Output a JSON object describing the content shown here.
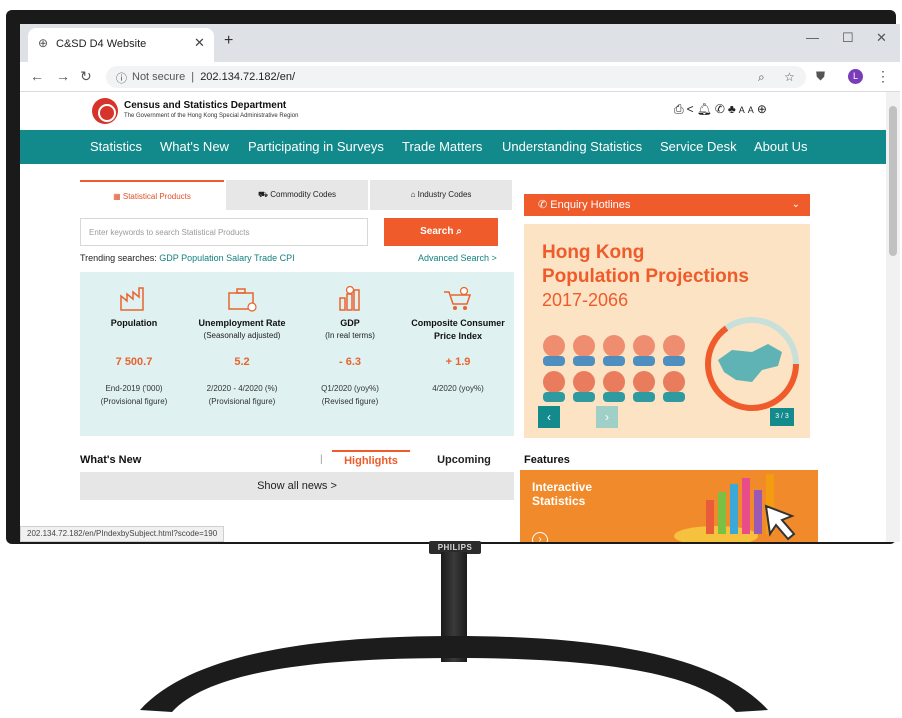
{
  "browser": {
    "tab_title": "C&SD D4 Website",
    "tab_close": "✕",
    "new_tab": "+",
    "address_security": "Not secure",
    "address_separator": "|",
    "address_url": "202.134.72.182/en/",
    "profile_initial": "L",
    "status_url": "202.134.72.182/en/PIndexbySubject.html?scode=190"
  },
  "header": {
    "dept_name": "Census and Statistics Department",
    "dept_subtitle": "The Government of the Hong Kong Special Administrative Region",
    "tools_icons": [
      "print-icon",
      "share-icon",
      "bell-icon",
      "phone-icon",
      "sitemap-icon",
      "font-size-icon",
      "globe-icon"
    ]
  },
  "nav": {
    "items": [
      "Statistics",
      "What's New",
      "Participating in Surveys",
      "Trade Matters",
      "Understanding Statistics",
      "Service Desk",
      "About Us"
    ]
  },
  "search": {
    "tabs": [
      "Statistical Products",
      "Commodity Codes",
      "Industry Codes"
    ],
    "placeholder": "Enter keywords to search Statistical Products",
    "button_label": "Search",
    "trending_label": "Trending searches:",
    "trending_terms": "GDP Population Salary Trade CPI",
    "advanced_search": "Advanced Search >"
  },
  "stats": [
    {
      "name": "Population",
      "note": "",
      "value": "7 500.7",
      "period": "End-2019 ('000)",
      "period_note": "(Provisional figure)"
    },
    {
      "name": "Unemployment Rate",
      "note": "(Seasonally adjusted)",
      "value": "5.2",
      "period": "2/2020 - 4/2020 (%)",
      "period_note": "(Provisional figure)"
    },
    {
      "name": "GDP",
      "note": "(In real terms)",
      "value": "- 6.3",
      "period": "Q1/2020 (yoy%)",
      "period_note": "(Revised figure)"
    },
    {
      "name": "Composite Consumer",
      "note": "Price Index",
      "value": "+ 1.9",
      "period": "4/2020 (yoy%)",
      "period_note": ""
    }
  ],
  "enquiry": {
    "label": "Enquiry Hotlines",
    "chevron": "⌄"
  },
  "banner": {
    "line1": "Hong Kong",
    "line2": "Population Projections",
    "line3": "2017-2066",
    "prev": "‹",
    "next": "›",
    "counter": "3 / 3"
  },
  "news": {
    "heading": "What's New",
    "separator": "|",
    "tab_highlights": "Highlights",
    "tab_upcoming": "Upcoming",
    "show_all": "Show all news >"
  },
  "features": {
    "heading": "Features",
    "card_line1": "Interactive",
    "card_line2": "Statistics"
  },
  "monitor": {
    "brand": "PHILIPS"
  },
  "colors": {
    "teal": "#128a8b",
    "orange": "#ef5b2a",
    "panel": "#dff1f1",
    "banner": "#fbe3c4"
  }
}
